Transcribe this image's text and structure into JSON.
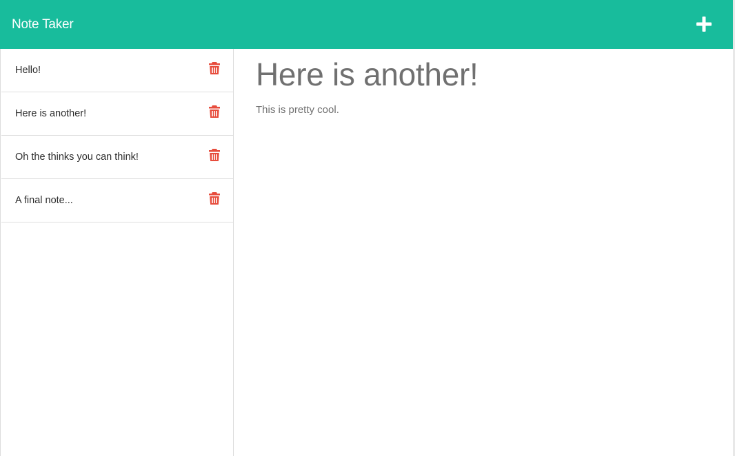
{
  "navbar": {
    "brand": "Note Taker",
    "new_note_icon": "plus-icon",
    "background": "#18bc9c"
  },
  "sidebar": {
    "notes": [
      {
        "title": "Hello!",
        "delete_icon": "trash-icon"
      },
      {
        "title": "Here is another!",
        "delete_icon": "trash-icon"
      },
      {
        "title": "Oh the thinks you can think!",
        "delete_icon": "trash-icon"
      },
      {
        "title": "A final note...",
        "delete_icon": "trash-icon"
      }
    ],
    "delete_color": "#e74c3c"
  },
  "editor": {
    "title": "Here is another!",
    "body": "This is pretty cool."
  }
}
